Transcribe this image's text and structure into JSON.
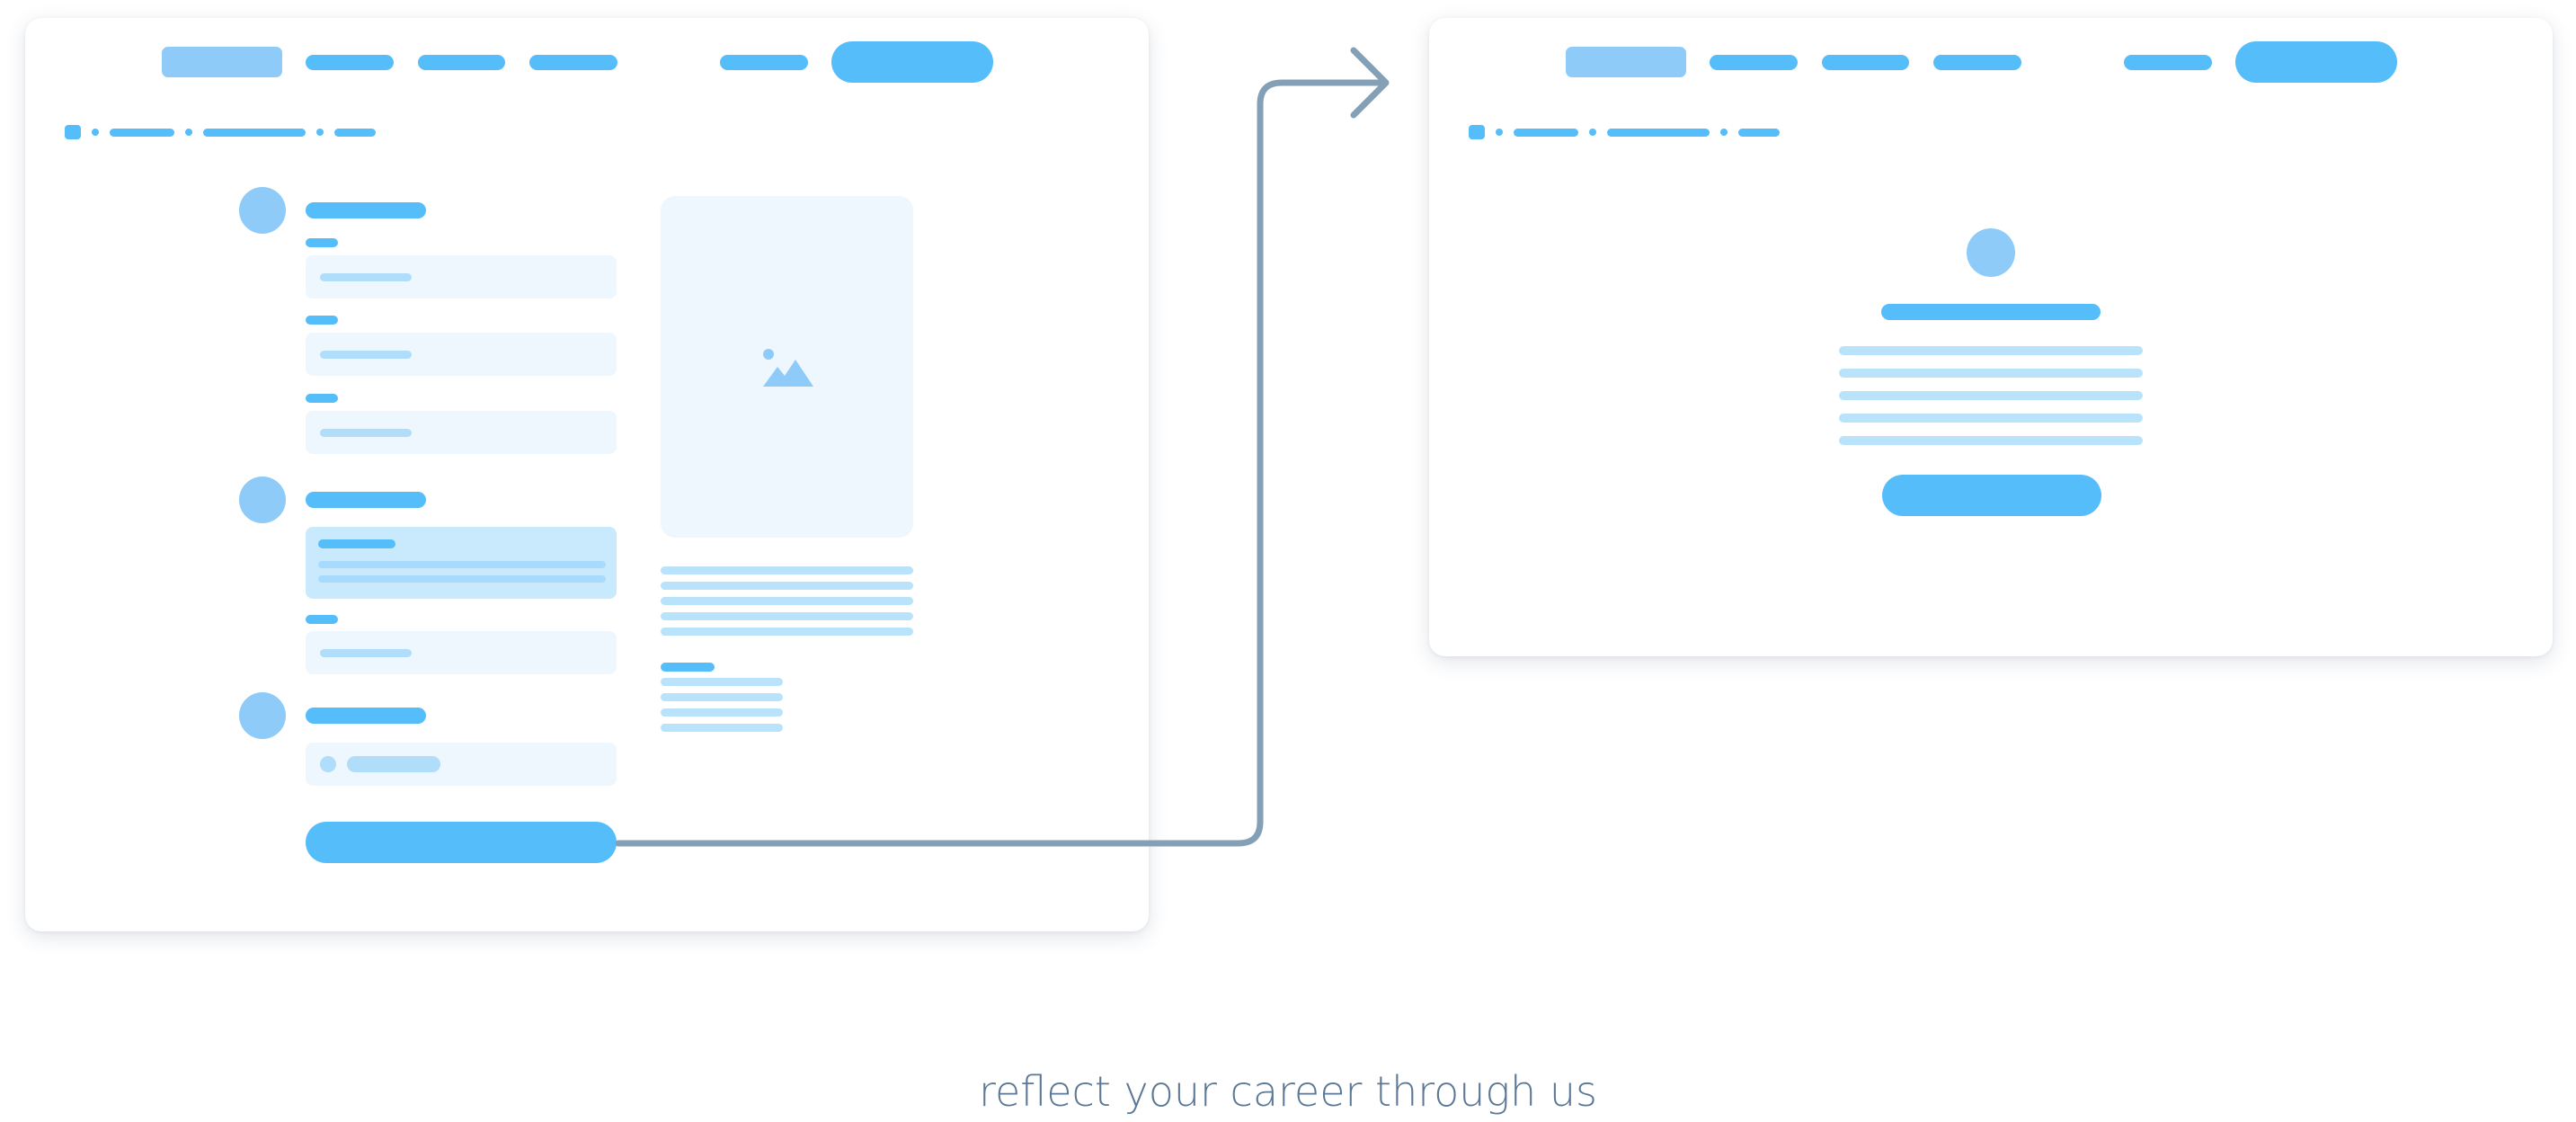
{
  "caption": "reflect your career through us",
  "colors": {
    "primary": "#56bdfb",
    "primary_soft": "#8ecbf9",
    "line_light": "#b9e3fb",
    "field_bg": "#eef7fd",
    "field_active_bg": "#c9e9fc",
    "field_placeholder": "#b0ddfa",
    "image_bg": "#eef7fd",
    "connector": "#84a0b6",
    "caption": "#5b7896"
  },
  "icons": {
    "image_placeholder": "image-icon",
    "connector_arrow": "arrow-right-icon"
  },
  "left_screen": {
    "nav_link_count": 4,
    "form_sections": 3,
    "description_lines": 5,
    "list_lines": 4
  },
  "right_screen": {
    "nav_link_count": 4,
    "body_lines": 5
  }
}
